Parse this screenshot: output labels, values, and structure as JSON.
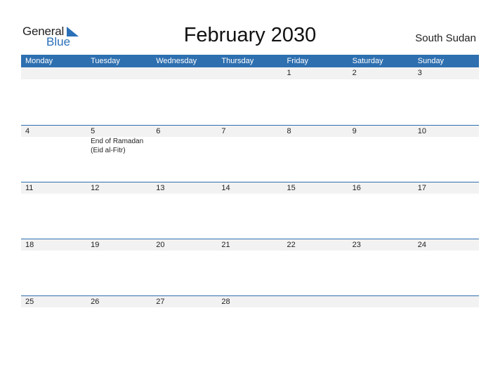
{
  "logo": {
    "word1": "General",
    "word2": "Blue",
    "brand_color": "#2a70b8"
  },
  "title": "February 2030",
  "country": "South Sudan",
  "header_color": "#2e6fb0",
  "weekdays": [
    "Monday",
    "Tuesday",
    "Wednesday",
    "Thursday",
    "Friday",
    "Saturday",
    "Sunday"
  ],
  "weeks": [
    {
      "days": [
        {
          "num": "",
          "event": ""
        },
        {
          "num": "",
          "event": ""
        },
        {
          "num": "",
          "event": ""
        },
        {
          "num": "",
          "event": ""
        },
        {
          "num": "1",
          "event": ""
        },
        {
          "num": "2",
          "event": ""
        },
        {
          "num": "3",
          "event": ""
        }
      ]
    },
    {
      "days": [
        {
          "num": "4",
          "event": ""
        },
        {
          "num": "5",
          "event": "End of Ramadan (Eid al-Fitr)"
        },
        {
          "num": "6",
          "event": ""
        },
        {
          "num": "7",
          "event": ""
        },
        {
          "num": "8",
          "event": ""
        },
        {
          "num": "9",
          "event": ""
        },
        {
          "num": "10",
          "event": ""
        }
      ]
    },
    {
      "days": [
        {
          "num": "11",
          "event": ""
        },
        {
          "num": "12",
          "event": ""
        },
        {
          "num": "13",
          "event": ""
        },
        {
          "num": "14",
          "event": ""
        },
        {
          "num": "15",
          "event": ""
        },
        {
          "num": "16",
          "event": ""
        },
        {
          "num": "17",
          "event": ""
        }
      ]
    },
    {
      "days": [
        {
          "num": "18",
          "event": ""
        },
        {
          "num": "19",
          "event": ""
        },
        {
          "num": "20",
          "event": ""
        },
        {
          "num": "21",
          "event": ""
        },
        {
          "num": "22",
          "event": ""
        },
        {
          "num": "23",
          "event": ""
        },
        {
          "num": "24",
          "event": ""
        }
      ]
    },
    {
      "days": [
        {
          "num": "25",
          "event": ""
        },
        {
          "num": "26",
          "event": ""
        },
        {
          "num": "27",
          "event": ""
        },
        {
          "num": "28",
          "event": ""
        },
        {
          "num": "",
          "event": ""
        },
        {
          "num": "",
          "event": ""
        },
        {
          "num": "",
          "event": ""
        }
      ]
    }
  ]
}
